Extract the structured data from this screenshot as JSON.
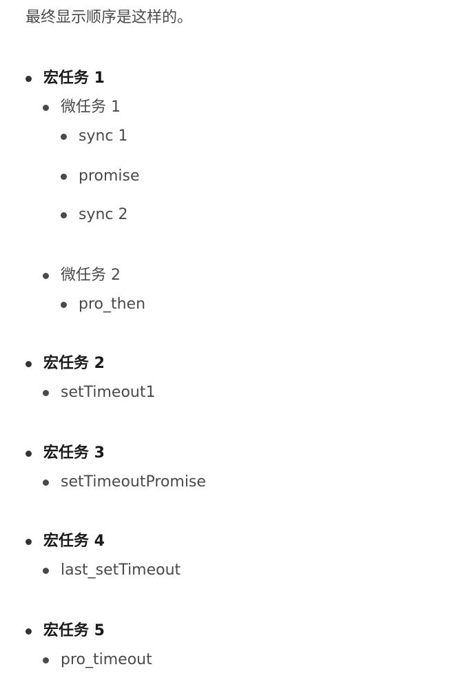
{
  "intro": "最终显示顺序是这样的。",
  "macro_tasks": [
    {
      "label": "宏任务 1",
      "children": [
        {
          "label": "微任务 1",
          "children": [
            "sync 1",
            "promise",
            "sync 2"
          ]
        },
        {
          "label": "微任务 2",
          "children": [
            "pro_then"
          ]
        }
      ]
    },
    {
      "label": "宏任务 2",
      "children": [
        {
          "label": "setTimeout1"
        }
      ]
    },
    {
      "label": "宏任务 3",
      "children": [
        {
          "label": "setTimeoutPromise"
        }
      ]
    },
    {
      "label": "宏任务 4",
      "children": [
        {
          "label": "last_setTimeout"
        }
      ]
    },
    {
      "label": "宏任务 5",
      "children": [
        {
          "label": "pro_timeout"
        }
      ]
    }
  ]
}
